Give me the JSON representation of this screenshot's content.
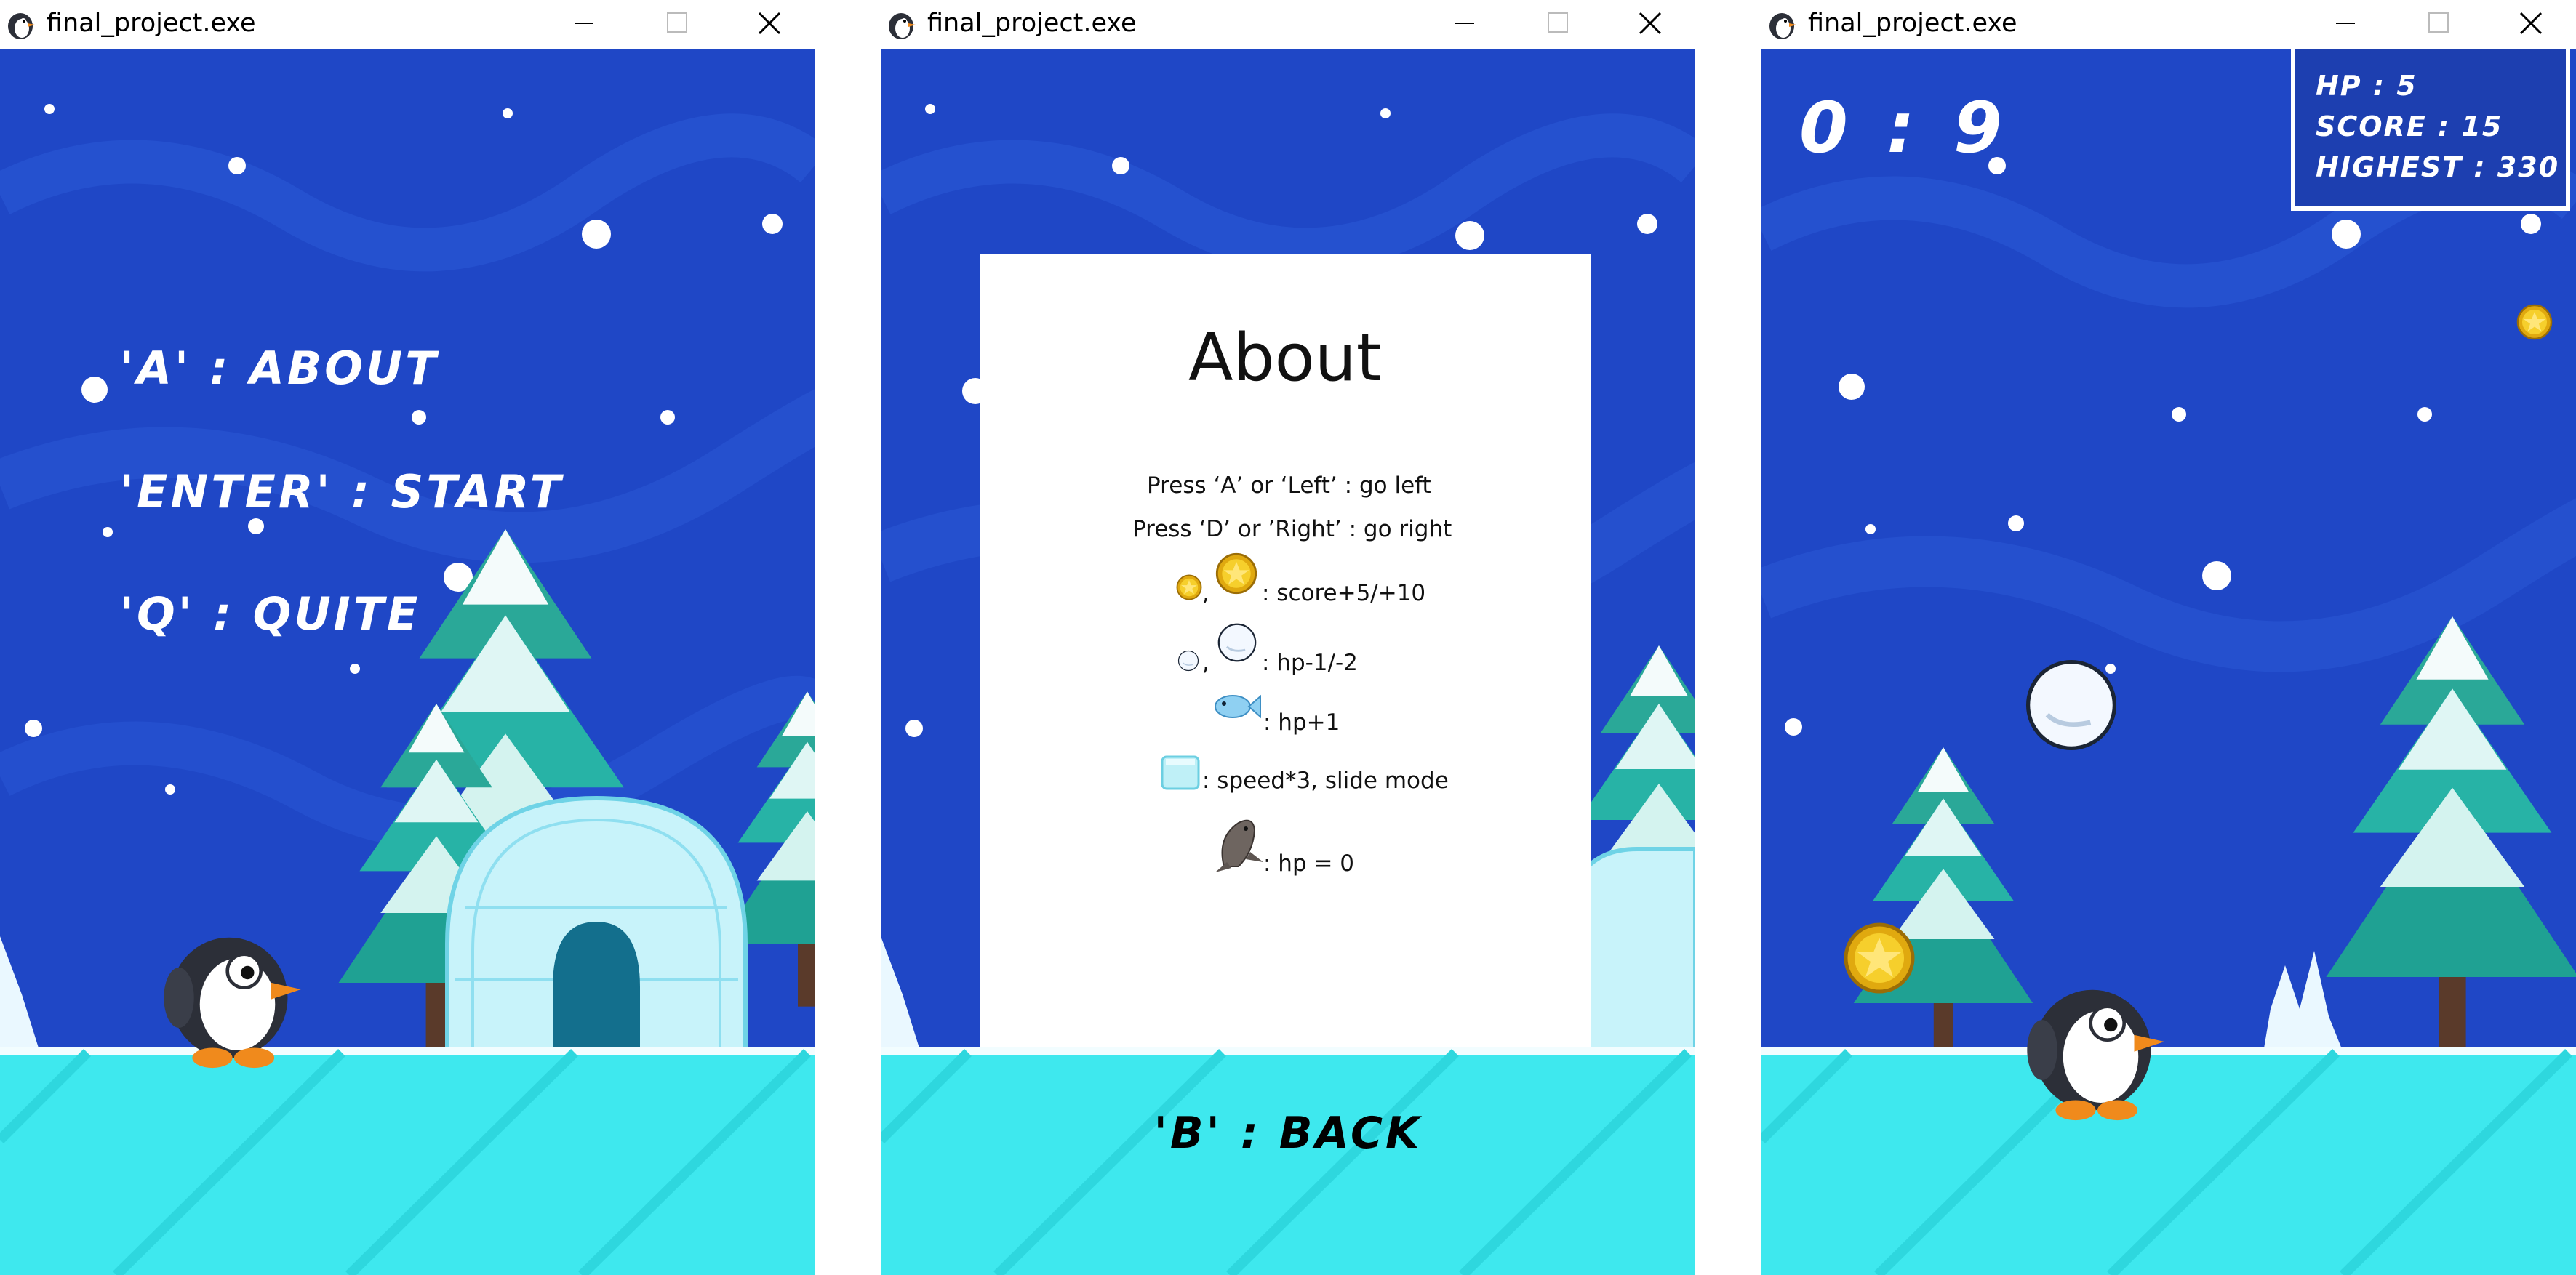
{
  "windows": [
    {
      "title": "final_project.exe",
      "screen": "menu",
      "menu": {
        "about": "'A' : ABOUT",
        "start": "'ENTER' : START",
        "quit": "'Q' : QUITE"
      }
    },
    {
      "title": "final_project.exe",
      "screen": "about",
      "about": {
        "heading": "About",
        "line_left": "Press  ‘A’ or  ‘Left’ : go left",
        "line_right": "Press  ‘D’ or ’Right’ : go right",
        "coin_sep": ",",
        "coin_text": ": score+5/+10",
        "snow_sep": ",",
        "snow_text": ": hp-1/-2",
        "fish_text": ": hp+1",
        "ice_text": ": speed*3, slide mode",
        "seal_text": ": hp = 0"
      },
      "back": "'B' : BACK"
    },
    {
      "title": "final_project.exe",
      "screen": "game",
      "timer": "0 : 9",
      "stats": {
        "hp": "HP : 5",
        "score": "SCORE : 15",
        "highest": "HIGHEST : 330"
      }
    }
  ],
  "colors": {
    "sky": "#1f47c6",
    "sky_swirl": "#2a58d6",
    "ground": "#3ee8ee",
    "tree": "#27b3a6",
    "coin": "#f2c21a",
    "titlebar": "#ffffff"
  },
  "icons": [
    "penguin-app-icon",
    "minimize-icon",
    "maximize-icon",
    "close-icon",
    "coin-icon",
    "snowball-icon",
    "fish-icon",
    "ice-block-icon",
    "seal-icon",
    "penguin-sprite",
    "igloo",
    "pine-tree"
  ]
}
